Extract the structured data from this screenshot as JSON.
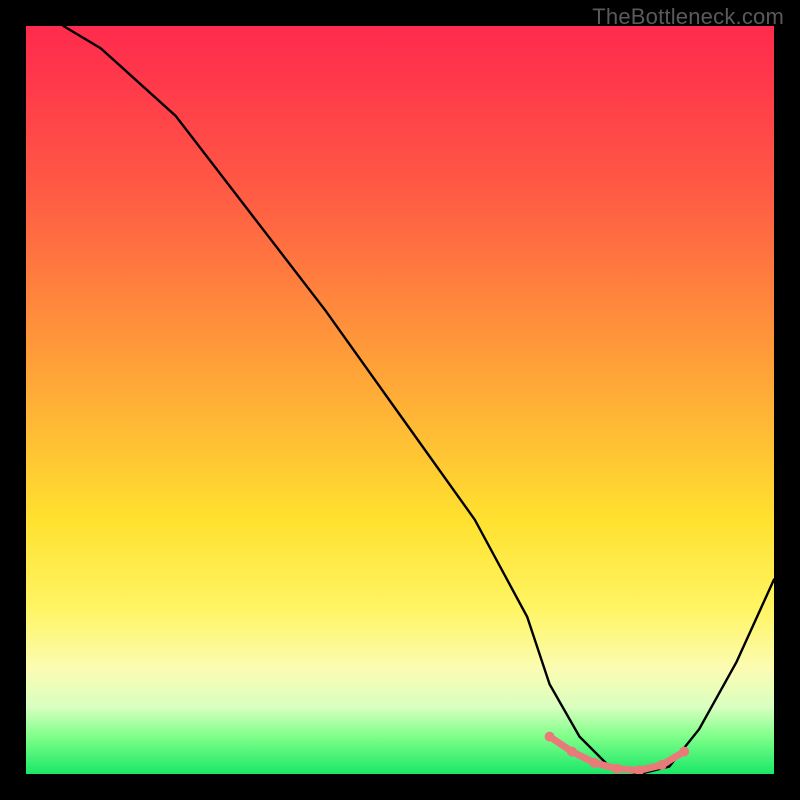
{
  "watermark": "TheBottleneck.com",
  "chart_data": {
    "type": "line",
    "title": "",
    "xlabel": "",
    "ylabel": "",
    "xlim": [
      0,
      100
    ],
    "ylim": [
      0,
      100
    ],
    "grid": false,
    "legend": false,
    "series": [
      {
        "name": "bottleneck-curve",
        "color": "#000000",
        "x": [
          5,
          10,
          20,
          30,
          40,
          50,
          60,
          67,
          70,
          74,
          78,
          82,
          86,
          90,
          95,
          100
        ],
        "values": [
          100,
          97,
          88,
          75,
          62,
          48,
          34,
          21,
          12,
          5,
          1,
          0,
          1,
          6,
          15,
          26
        ]
      },
      {
        "name": "optimal-range-highlight",
        "color": "#e97a7a",
        "x": [
          70,
          73,
          76,
          79,
          82,
          85,
          88
        ],
        "values": [
          5,
          3,
          1.5,
          0.7,
          0.5,
          1.2,
          3
        ]
      }
    ],
    "annotations": []
  },
  "colors": {
    "curve": "#000000",
    "highlight": "#e97a7a",
    "watermark": "#5a5a5a"
  }
}
